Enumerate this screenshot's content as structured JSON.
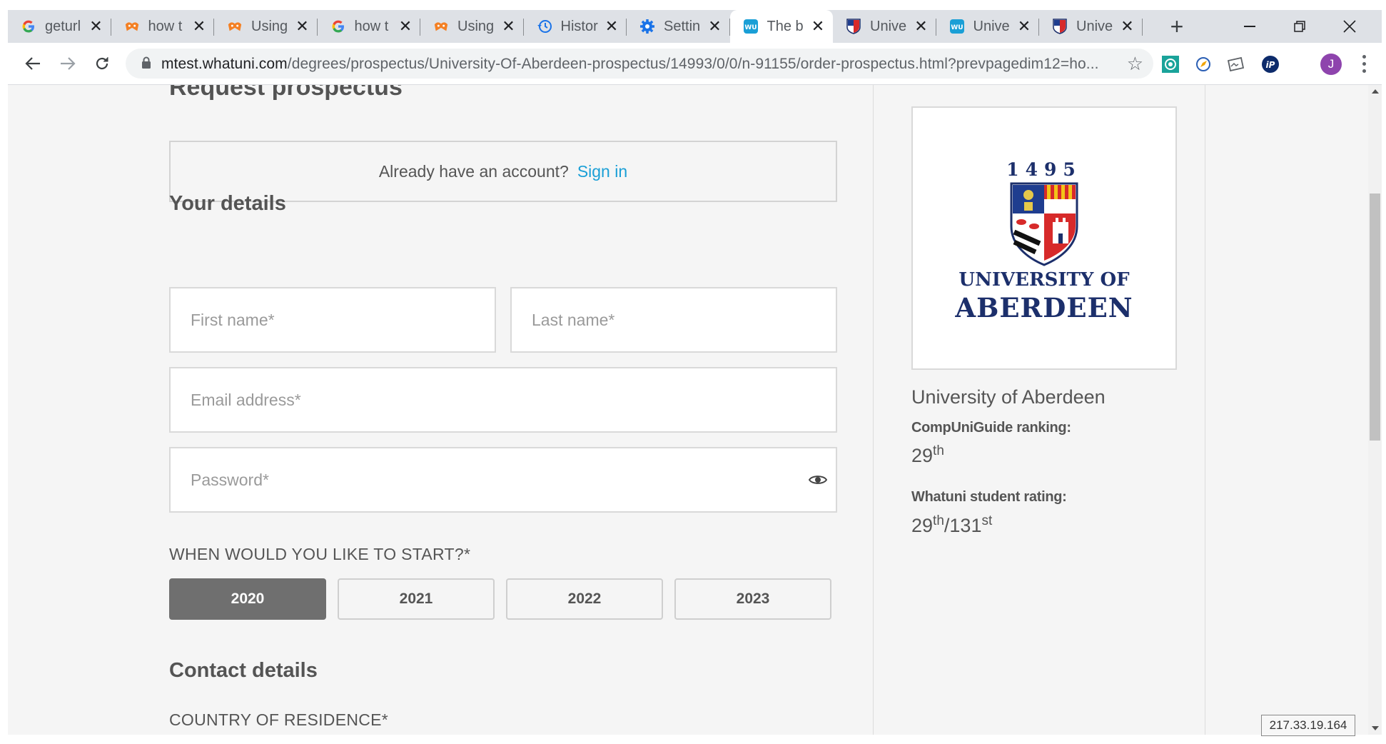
{
  "browser": {
    "tabs": [
      {
        "title": "geturl",
        "icon": "google-icon"
      },
      {
        "title": "how t",
        "icon": "stackexchange-icon"
      },
      {
        "title": "Using",
        "icon": "stackexchange-icon"
      },
      {
        "title": "how t",
        "icon": "google-icon"
      },
      {
        "title": "Using",
        "icon": "stackexchange-icon"
      },
      {
        "title": "Histor",
        "icon": "history-icon"
      },
      {
        "title": "Settin",
        "icon": "settings-gear-icon"
      },
      {
        "title": "The b",
        "icon": "whatuni-icon",
        "active": true
      },
      {
        "title": "Unive",
        "icon": "university-crest-icon"
      },
      {
        "title": "Unive",
        "icon": "whatuni-icon"
      },
      {
        "title": "Unive",
        "icon": "university-crest-icon"
      }
    ],
    "new_tab_label": "+",
    "url_host": "mtest.whatuni.com",
    "url_path": "/degrees/prospectus/University-Of-Aberdeen-prospectus/14993/0/0/n-91155/order-prospectus.html?prevpagedim12=ho...",
    "avatar_initial": "J",
    "colors": {
      "tabstrip": "#dee1e6",
      "avatar": "#8e44ad"
    }
  },
  "page": {
    "heading": "Request prospectus",
    "signin_prompt": "Already have an account?",
    "signin_link": "Sign in",
    "your_details_title": "Your details",
    "first_name_placeholder": "First name*",
    "last_name_placeholder": "Last name*",
    "email_placeholder": "Email address*",
    "password_placeholder": "Password*",
    "start_question": "WHEN WOULD YOU LIKE TO START?*",
    "years": [
      {
        "label": "2020",
        "selected": true
      },
      {
        "label": "2021",
        "selected": false
      },
      {
        "label": "2022",
        "selected": false
      },
      {
        "label": "2023",
        "selected": false
      }
    ],
    "contact_title": "Contact details",
    "country_label": "COUNTRY OF RESIDENCE*",
    "colors": {
      "link": "#1a9fd6",
      "selected_year": "#6f6f6f",
      "background": "#f5f5f5"
    }
  },
  "sidebar": {
    "logo_year": "1495",
    "logo_line1": "UNIVERSITY OF",
    "logo_line2": "ABERDEEN",
    "university_name": "University of Aberdeen",
    "compuni_label": "CompUniGuide ranking:",
    "compuni_rank": "29",
    "compuni_rank_suffix": "th",
    "whatuni_label": "Whatuni student rating:",
    "whatuni_rank": "29",
    "whatuni_rank_suffix": "th",
    "whatuni_total": "/131",
    "whatuni_total_suffix": "st",
    "colors": {
      "logo_navy": "#1c2f6b"
    }
  },
  "overlay": {
    "ip_address": "217.33.19.164"
  }
}
